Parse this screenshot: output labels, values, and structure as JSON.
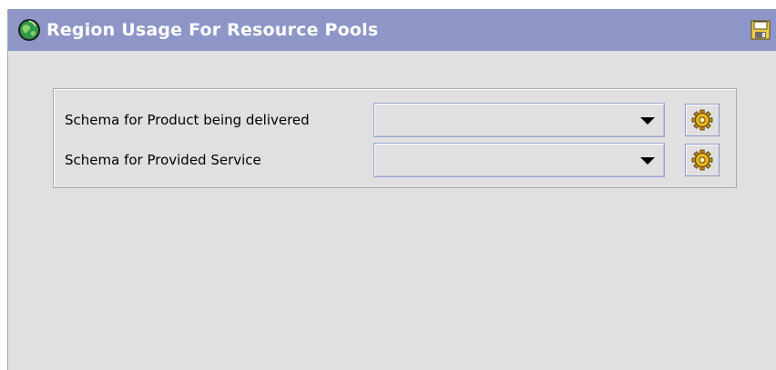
{
  "window": {
    "title": "Region Usage For Resource Pools",
    "title_icon": "globe-icon",
    "save_icon": "save-icon"
  },
  "form": {
    "rows": [
      {
        "label": "Schema for Product being delivered",
        "value": "",
        "button_icon": "gear-icon"
      },
      {
        "label": "Schema for Provided Service",
        "value": "",
        "button_icon": "gear-icon"
      }
    ]
  },
  "colors": {
    "titlebar": "#8e96c8",
    "background": "#e0e0e0",
    "title_text": "#ffffff"
  }
}
